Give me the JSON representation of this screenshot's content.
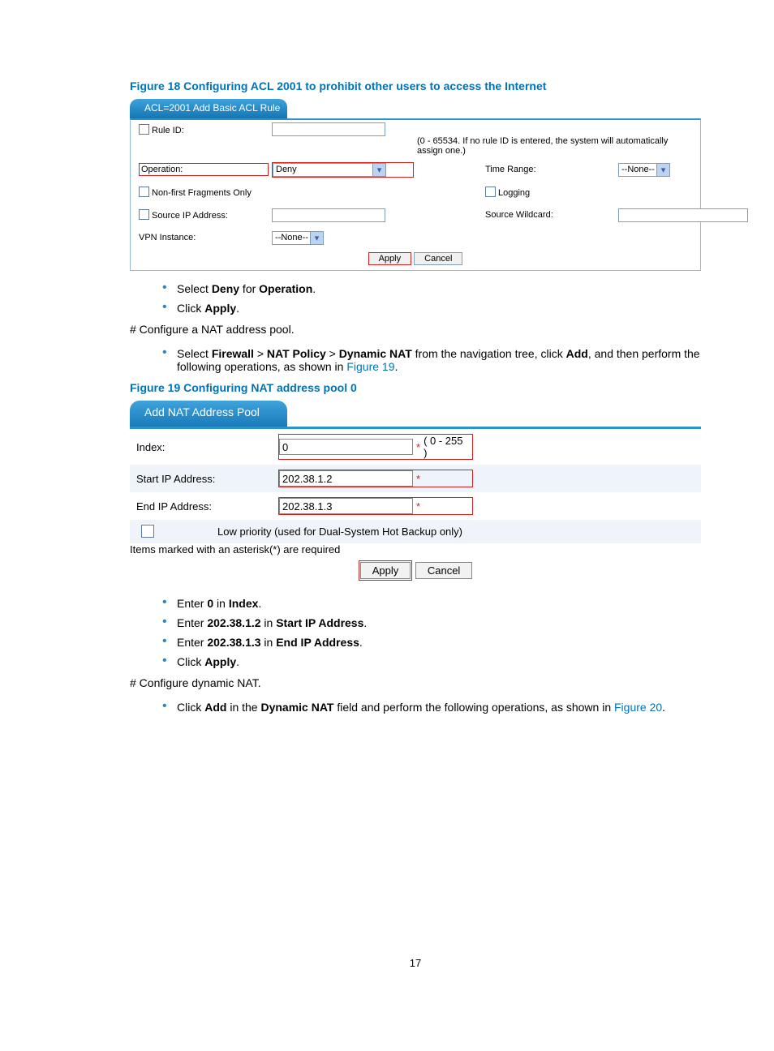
{
  "figure18": {
    "title": "Figure 18 Configuring ACL 2001 to prohibit other users to access the Internet",
    "tab": "ACL=2001 Add Basic ACL Rule",
    "labels": {
      "ruleId": "Rule ID:",
      "hint": "(0 - 65534. If no rule ID is entered, the system will automatically assign one.)",
      "operation": "Operation:",
      "operationValue": "Deny",
      "timeRange": "Time Range:",
      "none": "--None--",
      "nonFirst": "Non-first Fragments Only",
      "logging": "Logging",
      "sourceIp": "Source IP Address:",
      "sourceWildcard": "Source Wildcard:",
      "vpn": "VPN Instance:"
    },
    "buttons": {
      "apply": "Apply",
      "cancel": "Cancel"
    }
  },
  "instr1": {
    "b1_pre": "Select ",
    "b1_v1": "Deny",
    "b1_mid": " for ",
    "b1_v2": "Operation",
    "b1_post": ".",
    "b2_pre": "Click ",
    "b2_v": "Apply",
    "b2_post": "."
  },
  "line1": "# Configure a NAT address pool.",
  "instr2": {
    "pre": "Select ",
    "s1": "Firewall",
    "gt1": " > ",
    "s2": "NAT Policy",
    "gt2": " > ",
    "s3": "Dynamic NAT",
    "mid1": " from the navigation tree, click ",
    "add": "Add",
    "mid2": ", and then perform the following operations, as shown in ",
    "figref": "Figure 19",
    "post": "."
  },
  "figure19": {
    "title": "Figure 19 Configuring NAT address pool 0",
    "tab": "Add NAT Address Pool",
    "labels": {
      "index": "Index:",
      "indexVal": "0",
      "indexHint": "( 0 - 255 )",
      "start": "Start IP Address:",
      "startVal": "202.38.1.2",
      "end": "End IP Address:",
      "endVal": "202.38.1.3",
      "low": "Low priority (used for Dual-System Hot Backup only)",
      "footnote": "Items marked with an asterisk(*) are required"
    },
    "buttons": {
      "apply": "Apply",
      "cancel": "Cancel"
    }
  },
  "instr3": {
    "l1_pre": "Enter ",
    "l1_v": "0",
    "l1_mid": " in ",
    "l1_f": "Index",
    "l1_post": ".",
    "l2_pre": "Enter ",
    "l2_v": "202.38.1.2",
    "l2_mid": " in ",
    "l2_f": "Start IP Address",
    "l2_post": ".",
    "l3_pre": "Enter ",
    "l3_v": "202.38.1.3",
    "l3_mid": " in ",
    "l3_f": "End IP Address",
    "l3_post": ".",
    "l4_pre": "Click ",
    "l4_v": "Apply",
    "l4_post": "."
  },
  "line2": "# Configure dynamic NAT.",
  "instr4": {
    "pre": "Click ",
    "add": "Add",
    "mid1": " in the ",
    "field": "Dynamic NAT",
    "mid2": " field and perform the following operations, as shown in ",
    "figref": "Figure 20",
    "post": "."
  },
  "pagenum": "17"
}
